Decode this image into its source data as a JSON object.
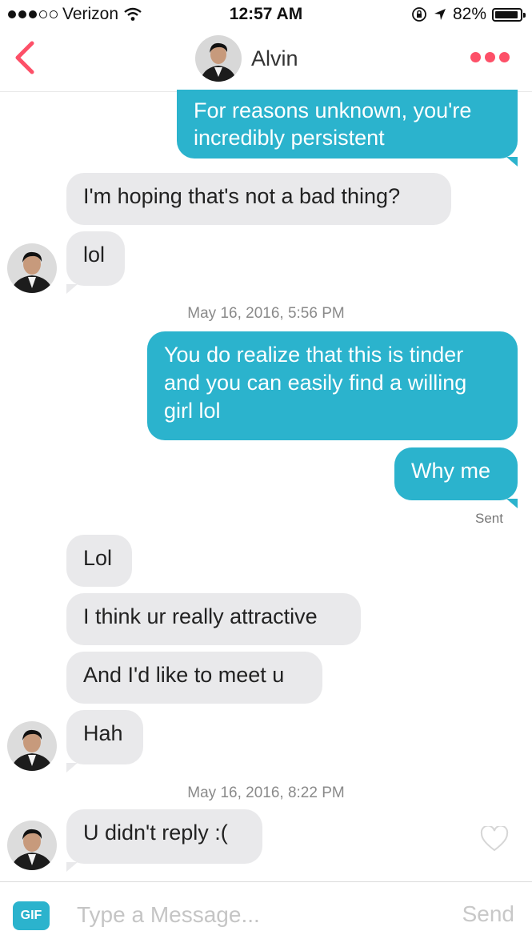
{
  "status_bar": {
    "carrier": "Verizon",
    "time": "12:57 AM",
    "battery": "82%"
  },
  "header": {
    "contact_name": "Alvin"
  },
  "messages": {
    "m1": "For reasons unknown, you're incredibly persistent",
    "m2": "I'm hoping that's not a bad thing?",
    "m3": "lol",
    "stamp1": "May 16, 2016, 5:56 PM",
    "m4_line1": "You do realize that this is tinder",
    "m4_line2": "and you can easily find a willing",
    "m4_line3": "girl lol",
    "m5": "Why me",
    "sent_label": "Sent",
    "m6": "Lol",
    "m7": "I think ur really attractive",
    "m8": "And I'd like to meet u",
    "m9": "Hah",
    "stamp2": "May 16, 2016, 8:22 PM",
    "m10": "U didn't reply :("
  },
  "composer": {
    "gif_label": "GIF",
    "placeholder": "Type a Message...",
    "send_label": "Send"
  },
  "colors": {
    "accent": "#fd5068",
    "outgoing_bubble": "#2bb3cd",
    "incoming_bubble": "#e9e9eb"
  }
}
